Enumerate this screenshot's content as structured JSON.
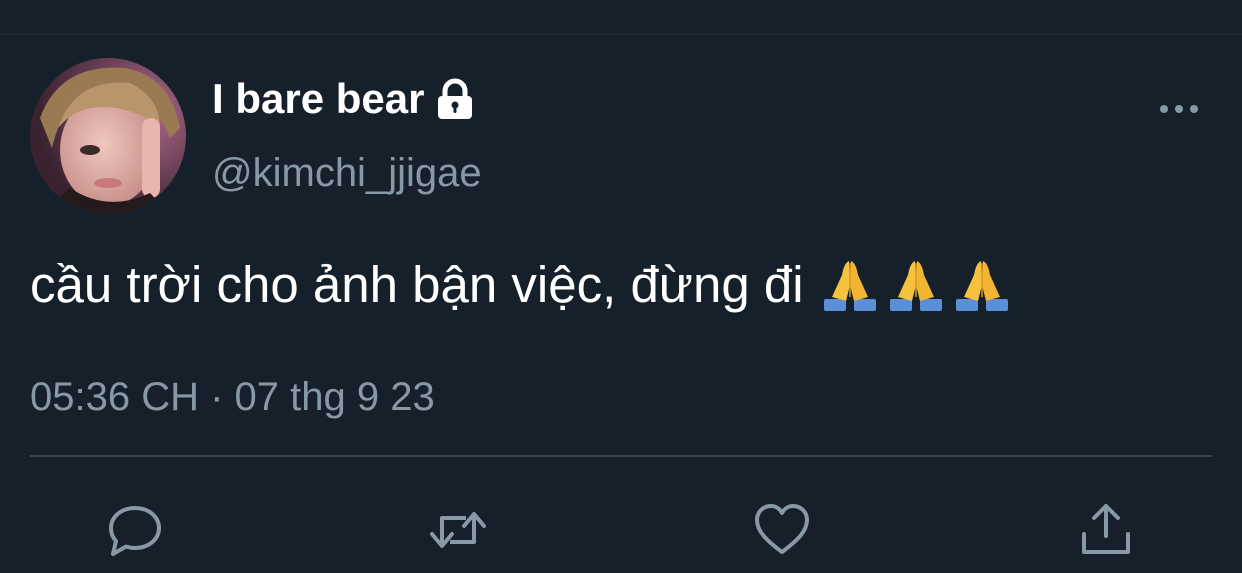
{
  "tweet": {
    "author": {
      "display_name": "I bare bear",
      "handle": "@kimchi_jjigae",
      "protected": true
    },
    "text": "cầu trời cho ảnh bận việc, đừng đi",
    "emojis": [
      "🙏",
      "🙏",
      "🙏"
    ],
    "timestamp": "05:36 CH · 07 thg 9 23"
  },
  "icons": {
    "lock": "lock-icon",
    "more": "more-horizontal-icon",
    "reply": "reply-icon",
    "retweet": "retweet-icon",
    "like": "heart-icon",
    "share": "share-icon"
  },
  "colors": {
    "background": "#15202b",
    "text_primary": "#ffffff",
    "text_secondary": "#8899a6",
    "divider": "#38444d"
  }
}
